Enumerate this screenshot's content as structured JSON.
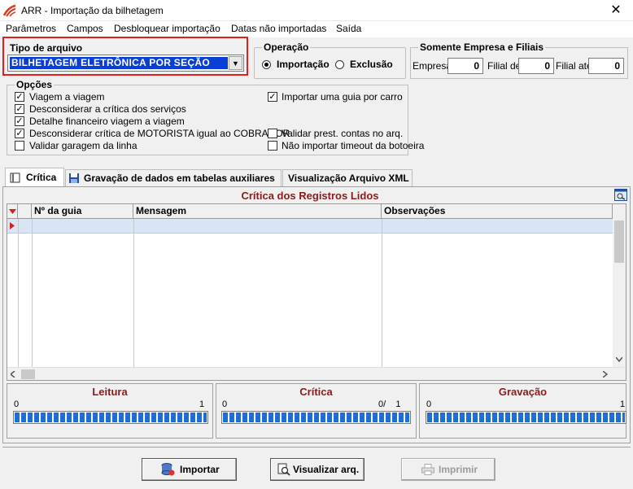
{
  "window": {
    "title": "ARR - Importação da bilhetagem",
    "close_label": "✕"
  },
  "menu": {
    "items": [
      {
        "label": "Parâmetros"
      },
      {
        "label": "Campos"
      },
      {
        "label": "Desbloquear importação"
      },
      {
        "label": "Datas não importadas"
      },
      {
        "label": "Saída"
      }
    ]
  },
  "tipo_arquivo": {
    "label": "Tipo de arquivo",
    "selected": "BILHETAGEM ELETRÔNICA POR SEÇÃO"
  },
  "operacao": {
    "label": "Operação",
    "importacao": "Importação",
    "exclusao": "Exclusão",
    "selected": "Importação"
  },
  "empresa": {
    "label": "Somente Empresa e Filiais",
    "empresa_label": "Empresa",
    "empresa_value": "0",
    "filial_de_label": "Filial de",
    "filial_de_value": "0",
    "filial_ate_label": "Filial até",
    "filial_ate_value": "0"
  },
  "opcoes": {
    "label": "Opções",
    "items": [
      {
        "label": "Viagem a viagem",
        "checked": true
      },
      {
        "label": "Desconsiderar a crítica dos serviços",
        "checked": true
      },
      {
        "label": "Detalhe financeiro viagem a viagem",
        "checked": true
      },
      {
        "label": "Desconsiderar crítica de MOTORISTA igual ao COBRADOR",
        "checked": true
      },
      {
        "label": "Validar garagem da linha",
        "checked": false
      },
      {
        "label": "Importar uma guia por carro",
        "checked": true
      },
      {
        "label": "Validar prest. contas no arq.",
        "checked": false
      },
      {
        "label": "Não importar timeout da botoeira",
        "checked": false
      }
    ]
  },
  "tabs": [
    {
      "label": "Crítica",
      "icon": "book-icon",
      "active": true
    },
    {
      "label": "Gravação de dados em tabelas auxiliares",
      "icon": "floppy-disk-icon",
      "active": false
    },
    {
      "label": "Visualização Arquivo XML",
      "icon": "",
      "active": false
    }
  ],
  "grid": {
    "title": "Crítica dos Registros Lidos",
    "columns": [
      "Nº da guia",
      "Mensagem",
      "Observações"
    ]
  },
  "progress": [
    {
      "title": "Leitura",
      "min": "0",
      "max": "1",
      "fraction": 1.0
    },
    {
      "title": "Crítica",
      "min": "0",
      "max": "0/    1",
      "fraction": 1.0
    },
    {
      "title": "Gravação",
      "min": "0",
      "max": "1",
      "fraction": 1.0
    }
  ],
  "buttons": {
    "importar": "Importar",
    "visualizar": "Visualizar arq.",
    "imprimir": "Imprimir"
  },
  "colors": {
    "accent_red": "#8b1a1a",
    "highlight": "#e02020",
    "selection_blue": "#0a3fd6",
    "progress_blue": "#1d6fd6"
  }
}
